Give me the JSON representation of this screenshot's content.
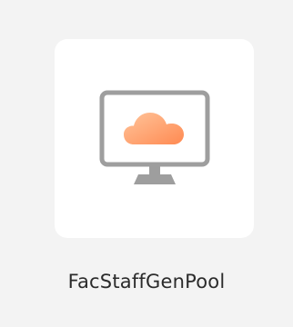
{
  "desktop": {
    "background_color": "#f3f3f3",
    "tile": {
      "background_color": "#ffffff",
      "icon": "cloud-desktop-icon",
      "monitor_color": "#9e9e9e",
      "cloud_gradient": [
        "#ffb98a",
        "#ff8c55"
      ]
    },
    "label": "FacStaffGenPool"
  }
}
